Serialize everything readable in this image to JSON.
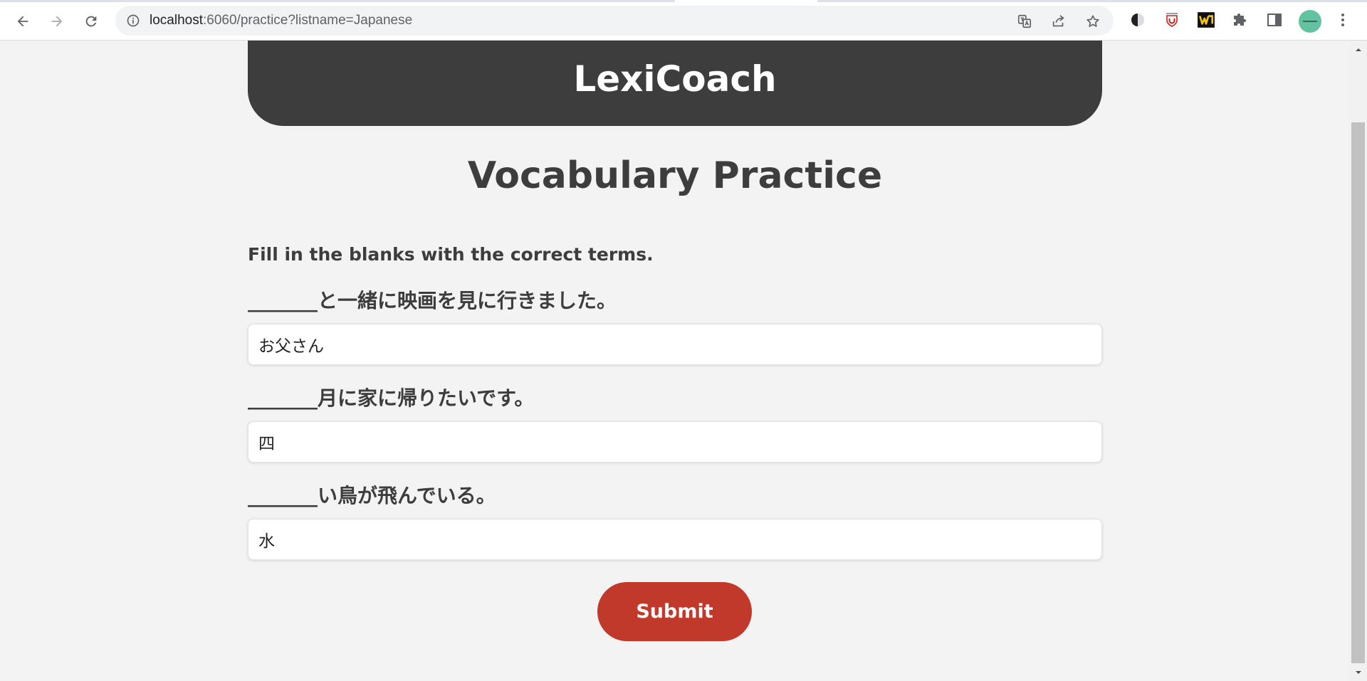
{
  "browser": {
    "url_host": "localhost",
    "url_rest": ":6060/practice?listname=Japanese",
    "icons": {
      "back": "arrow-left-icon",
      "forward": "arrow-right-icon",
      "reload": "reload-icon",
      "site_info": "info-icon",
      "translate": "translate-icon",
      "share": "share-icon",
      "bookmark": "star-icon",
      "dark_reader": "half-moon-icon",
      "extension_shield": "shield-extension-icon",
      "extension_w": "w-extension-icon",
      "extensions": "puzzle-icon",
      "side_panel": "side-panel-icon",
      "menu": "kebab-menu-icon"
    }
  },
  "header": {
    "brand": "LexiCoach"
  },
  "main": {
    "title": "Vocabulary Practice",
    "instructions": "Fill in the blanks with the correct terms.",
    "questions": [
      {
        "prompt": "_______と一緒に映画を見に行きました。",
        "answer": "お父さん"
      },
      {
        "prompt": "_______月に家に帰りたいです。",
        "answer": "四"
      },
      {
        "prompt": "_______い鳥が飛んでいる。",
        "answer": "水"
      }
    ],
    "submit_label": "Submit"
  },
  "colors": {
    "banner": "#3d3d3d",
    "page_background": "#f3f3f3",
    "text": "#3d3d3d",
    "submit": "#c0392b"
  }
}
